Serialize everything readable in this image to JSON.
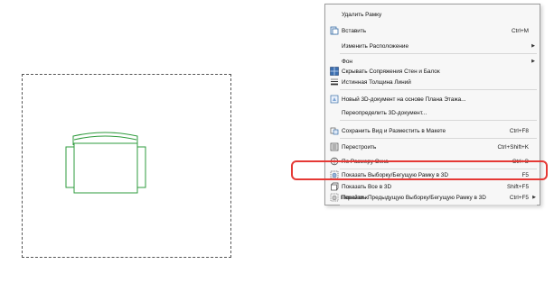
{
  "menu": {
    "items": [
      {
        "label": "Удалить Рамку",
        "shortcut": "",
        "submenu": false,
        "icon": ""
      },
      {
        "label": "Вставить",
        "shortcut": "Ctrl+M",
        "submenu": false,
        "icon": "paste-icon"
      },
      {
        "label": "Изменить Расположение",
        "shortcut": "",
        "submenu": true,
        "icon": ""
      },
      {
        "label": "Фон",
        "shortcut": "",
        "submenu": true,
        "icon": ""
      },
      {
        "label": "Скрывать Сопряжения Стен и Балок",
        "shortcut": "",
        "submenu": false,
        "icon": "hide-junctions-icon"
      },
      {
        "label": "Истинная Толщина Линий",
        "shortcut": "",
        "submenu": false,
        "icon": "line-weight-icon"
      },
      {
        "label": "Новый 3D-документ на основе Плана Этажа...",
        "shortcut": "",
        "submenu": false,
        "icon": "new-3d-document-icon"
      },
      {
        "label": "Переопределить 3D-документ...",
        "shortcut": "",
        "submenu": false,
        "icon": ""
      },
      {
        "label": "Сохранить Вид и Разместить в Макете",
        "shortcut": "Ctrl+F8",
        "submenu": false,
        "icon": "save-view-icon"
      },
      {
        "label": "Перестроить",
        "shortcut": "Ctrl+Shift+K",
        "submenu": false,
        "icon": "rebuild-icon"
      },
      {
        "label": "По Размеру Окна",
        "shortcut": "Ctrl+Э",
        "submenu": false,
        "icon": "fit-window-icon"
      },
      {
        "label": "Показать Выборку/Бегущую Рамку в 3D",
        "shortcut": "F5",
        "submenu": false,
        "icon": "show-selection-3d-icon"
      },
      {
        "label": "Показать Все в 3D",
        "shortcut": "Shift+F5",
        "submenu": false,
        "icon": "show-all-3d-icon"
      },
      {
        "label": "Показать Предыдущую Выборку/Бегущую Рамку в 3D",
        "shortcut": "Ctrl+F5",
        "submenu": false,
        "icon": "show-previous-3d-icon"
      },
      {
        "label": "Перейти к",
        "shortcut": "",
        "submenu": true,
        "icon": ""
      }
    ]
  },
  "colors": {
    "highlight": "#e53935",
    "armchair_stroke": "#2e9b3c",
    "frame": "#555555"
  }
}
